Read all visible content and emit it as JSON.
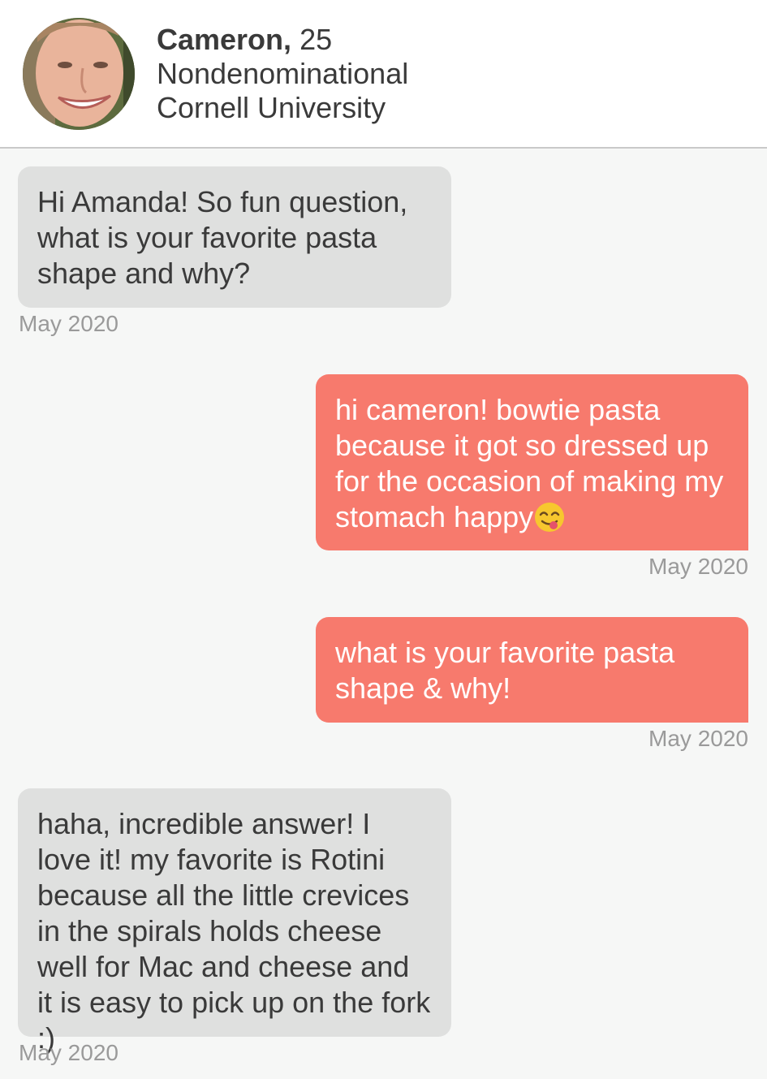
{
  "profile": {
    "name": "Cameron,",
    "age": "25",
    "religion": "Nondenominational",
    "school": "Cornell University"
  },
  "colors": {
    "sent_bubble": "#f77a6d",
    "received_bubble": "#dfe0df",
    "background": "#f6f7f6"
  },
  "messages": [
    {
      "direction": "received",
      "text": "Hi Amanda! So fun question, what is your favorite pasta shape and why?",
      "timestamp": "May 2020"
    },
    {
      "direction": "sent",
      "text": "hi cameron! bowtie pasta because it got so dressed up for the occasion of making my stomach happy",
      "emoji": "face-savoring-food-emoji",
      "timestamp": "May 2020"
    },
    {
      "direction": "sent",
      "text": "what is your favorite pasta shape & why!",
      "timestamp": "May 2020"
    },
    {
      "direction": "received",
      "text": "haha, incredible answer! I love it! my favorite is Rotini because all the little crevices in the spirals holds cheese well for Mac and cheese and it is easy to pick up on the fork :)",
      "timestamp": "May 2020"
    }
  ]
}
